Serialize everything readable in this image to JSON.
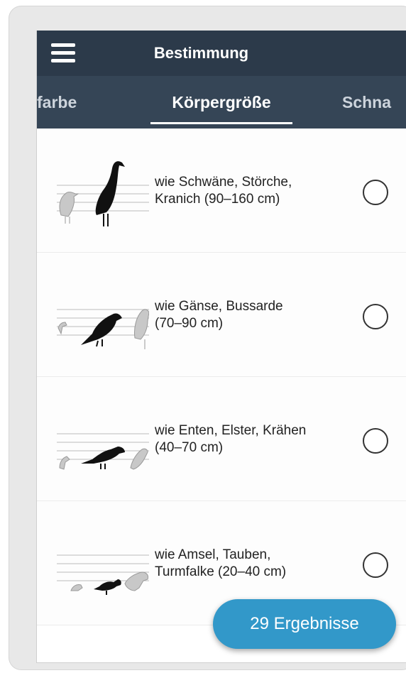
{
  "header": {
    "title": "Bestimmung",
    "menu_icon": "menu-icon"
  },
  "tabs": {
    "prev": "farbe",
    "active": "Körpergröße",
    "next": "Schna"
  },
  "options": [
    {
      "label_line1": "wie Schwäne, Störche,",
      "label_line2": "Kranich (90–160 cm)",
      "selected": false
    },
    {
      "label_line1": "wie Gänse, Bussarde",
      "label_line2": "(70–90 cm)",
      "selected": false
    },
    {
      "label_line1": "wie Enten, Elster, Krähen",
      "label_line2": "(40–70 cm)",
      "selected": false
    },
    {
      "label_line1": "wie Amsel, Tauben,",
      "label_line2": "Turmfalke (20–40 cm)",
      "selected": false
    }
  ],
  "results_button": {
    "label": "29 Ergebnisse"
  },
  "colors": {
    "topbar": "#2c3a4a",
    "tabbar": "#354556",
    "accent": "#3298c9"
  }
}
